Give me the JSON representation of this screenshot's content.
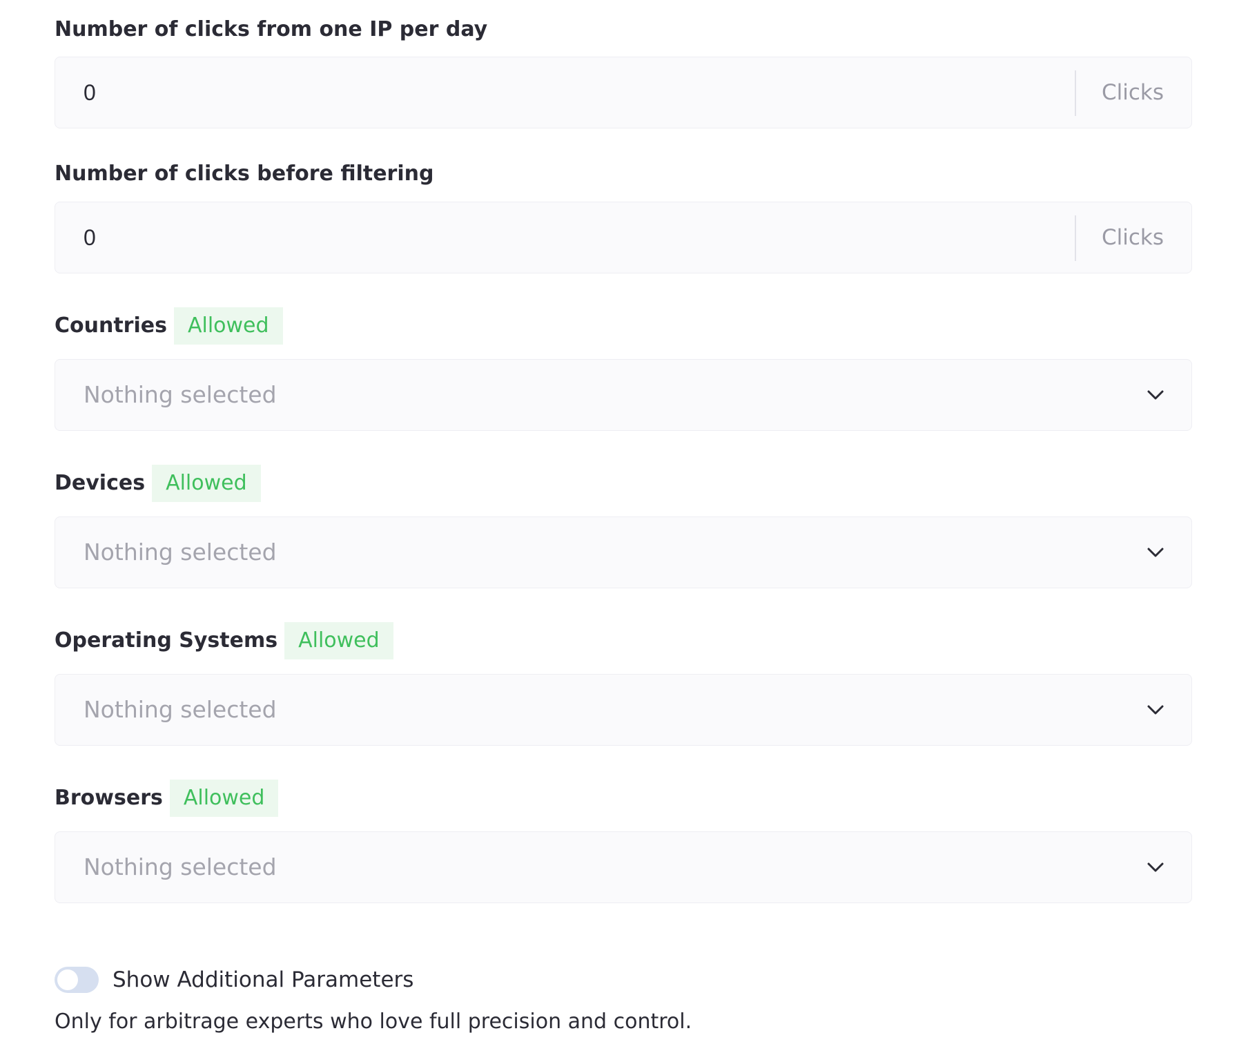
{
  "clicks_per_ip": {
    "label": "Number of clicks from one IP per day",
    "value": "0",
    "unit": "Clicks"
  },
  "clicks_before_filtering": {
    "label": "Number of clicks before filtering",
    "value": "0",
    "unit": "Clicks"
  },
  "countries": {
    "label": "Countries",
    "badge": "Allowed",
    "placeholder": "Nothing selected"
  },
  "devices": {
    "label": "Devices",
    "badge": "Allowed",
    "placeholder": "Nothing selected"
  },
  "operating_systems": {
    "label": "Operating Systems",
    "badge": "Allowed",
    "placeholder": "Nothing selected"
  },
  "browsers": {
    "label": "Browsers",
    "badge": "Allowed",
    "placeholder": "Nothing selected"
  },
  "additional": {
    "toggle_label": "Show Additional Parameters",
    "toggle_on": false,
    "hint": "Only for arbitrage experts who love full precision and control."
  },
  "colors": {
    "badge_text": "#3fbf5c",
    "badge_bg": "#ecf8ee",
    "field_bg": "#fafafc",
    "toggle_off": "#d6dff0"
  },
  "icons": {
    "dropdown": "chevron-down-icon"
  }
}
